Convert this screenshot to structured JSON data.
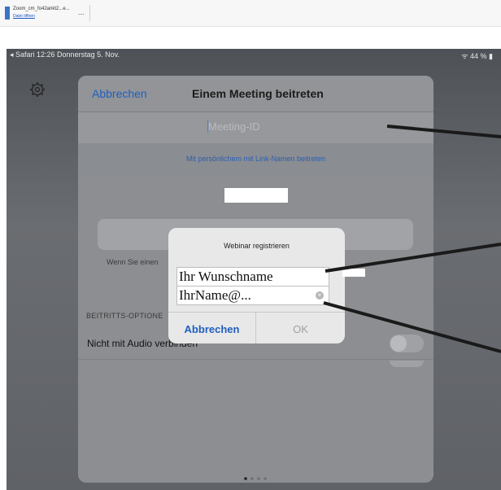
{
  "download_bar": {
    "file_name": "Zoom_cm_fo42ankt2...e...",
    "open_link": "Datei öffnen",
    "more": "..."
  },
  "status_bar": {
    "left": "◂ Safari  12:26  Donnerstag 5. Nov.",
    "right": "44 %"
  },
  "icons": {
    "settings": "gear-icon",
    "clear": "clear-icon",
    "file": "file-icon"
  },
  "sheet": {
    "cancel_label": "Abbrechen",
    "title": "Einem Meeting beitreten",
    "meeting_id_placeholder": "Meeting-ID",
    "link_name_join": "Mit persönlichem mit Link-Namen beitreten",
    "info_text": "Wenn Sie einen",
    "options_label": "BEITRITTS-OPTIONE",
    "audio_option": "Nicht mit Audio verbinden",
    "audio_toggle_on": false
  },
  "dialog": {
    "title": "Webinar registrieren",
    "name_value": "Ihr Wunschname",
    "email_value": "IhrName@...",
    "cancel_label": "Abbrechen",
    "ok_label": "OK"
  },
  "colors": {
    "accent_blue": "#1f5fbf",
    "annotation_line": "#1a1a1a"
  }
}
